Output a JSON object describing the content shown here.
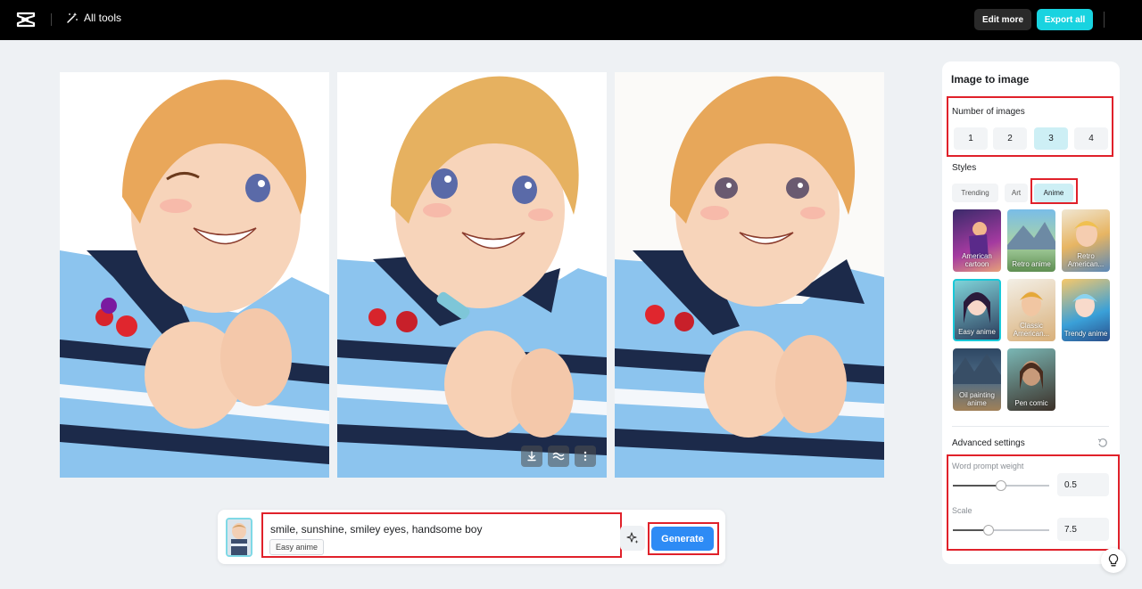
{
  "topbar": {
    "all_tools_label": "All tools",
    "edit_more_label": "Edit more",
    "export_all_label": "Export all"
  },
  "results": {
    "images": [
      {
        "alt": "anime-boy-winking"
      },
      {
        "alt": "anime-boy-smiling"
      },
      {
        "alt": "anime-boy-hands"
      }
    ],
    "actions": [
      "download-icon",
      "enhance-icon",
      "more-icon"
    ]
  },
  "prompt": {
    "text": "smile, sunshine, smiley eyes, handsome boy",
    "style_chip": "Easy anime",
    "generate_label": "Generate"
  },
  "panel": {
    "title": "Image to image",
    "number_label": "Number of images",
    "numbers": [
      "1",
      "2",
      "3",
      "4"
    ],
    "selected_number": "3",
    "styles_label": "Styles",
    "tabs": [
      "Trending",
      "Art",
      "Anime"
    ],
    "active_tab": "Anime",
    "styles": [
      {
        "label": "American cartoon"
      },
      {
        "label": "Retro anime"
      },
      {
        "label": "Retro American..."
      },
      {
        "label": "Easy anime"
      },
      {
        "label": "Classic American..."
      },
      {
        "label": "Trendy anime"
      },
      {
        "label": "Oil painting anime"
      },
      {
        "label": "Pen comic"
      }
    ],
    "selected_style": "Easy anime",
    "advanced_label": "Advanced settings",
    "word_prompt_weight_label": "Word prompt weight",
    "word_prompt_weight_value": "0.5",
    "word_prompt_weight_fraction": 0.5,
    "scale_label": "Scale",
    "scale_value": "7.5",
    "scale_fraction": 0.37
  },
  "colors": {
    "accent": "#19d3e0",
    "generate": "#2d8bf5",
    "highlight_box": "#e0212a"
  }
}
